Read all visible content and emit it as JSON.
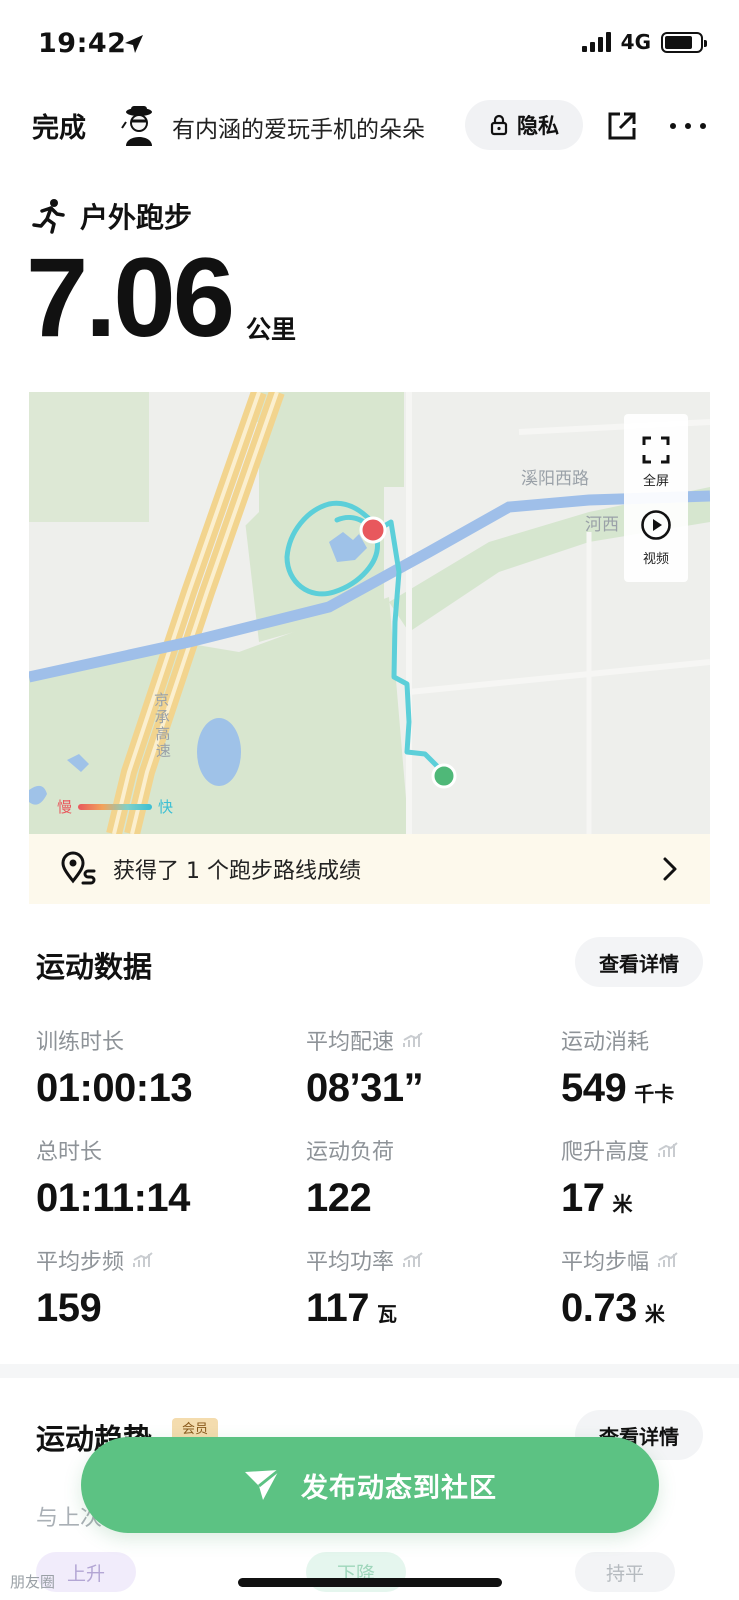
{
  "status_bar": {
    "time": "19:42",
    "network": "4G",
    "battery_level": 0.8
  },
  "top_bar": {
    "done_label": "完成",
    "username": "有内涵的爱玩手机的朵朵",
    "privacy_label": "隐私"
  },
  "activity": {
    "type": "户外跑步",
    "distance": "7.06",
    "distance_unit": "公里"
  },
  "map": {
    "fullscreen_label": "全屏",
    "video_label": "视频",
    "road_label_1": "溪阳西路",
    "road_label_2": "河西",
    "highway_label": "京承高速",
    "legend_slow": "慢",
    "legend_fast": "快",
    "colors": {
      "route": "#5ccfd9",
      "start": "#e8585d",
      "end": "#4fb878",
      "river": "#9fbfe9",
      "park": "#d8e6cf"
    }
  },
  "achievement": {
    "text": "获得了 1 个跑步路线成绩"
  },
  "sport_data": {
    "title": "运动数据",
    "detail_label": "查看详情",
    "stats": [
      {
        "label": "训练时长",
        "value": "01:00:13",
        "unit": ""
      },
      {
        "label": "平均配速",
        "value": "08’31”",
        "unit": ""
      },
      {
        "label": "运动消耗",
        "value": "549",
        "unit": "千卡"
      },
      {
        "label": "总时长",
        "value": "01:11:14",
        "unit": ""
      },
      {
        "label": "运动负荷",
        "value": "122",
        "unit": ""
      },
      {
        "label": "爬升高度",
        "value": "17",
        "unit": "米"
      },
      {
        "label": "平均步频",
        "value": "159",
        "unit": ""
      },
      {
        "label": "平均功率",
        "value": "117",
        "unit": "瓦"
      },
      {
        "label": "平均步幅",
        "value": "0.73",
        "unit": "米"
      }
    ]
  },
  "trend": {
    "title": "运动趋势",
    "member_badge": "会员",
    "detail_label": "查看详情",
    "compare_text": "与上次",
    "chip_up": "上升",
    "chip_down": "下降",
    "chip_flat": "持平"
  },
  "publish": {
    "label": "发布动态到社区",
    "color": "#5cc283"
  },
  "watermark": "朋友圈"
}
